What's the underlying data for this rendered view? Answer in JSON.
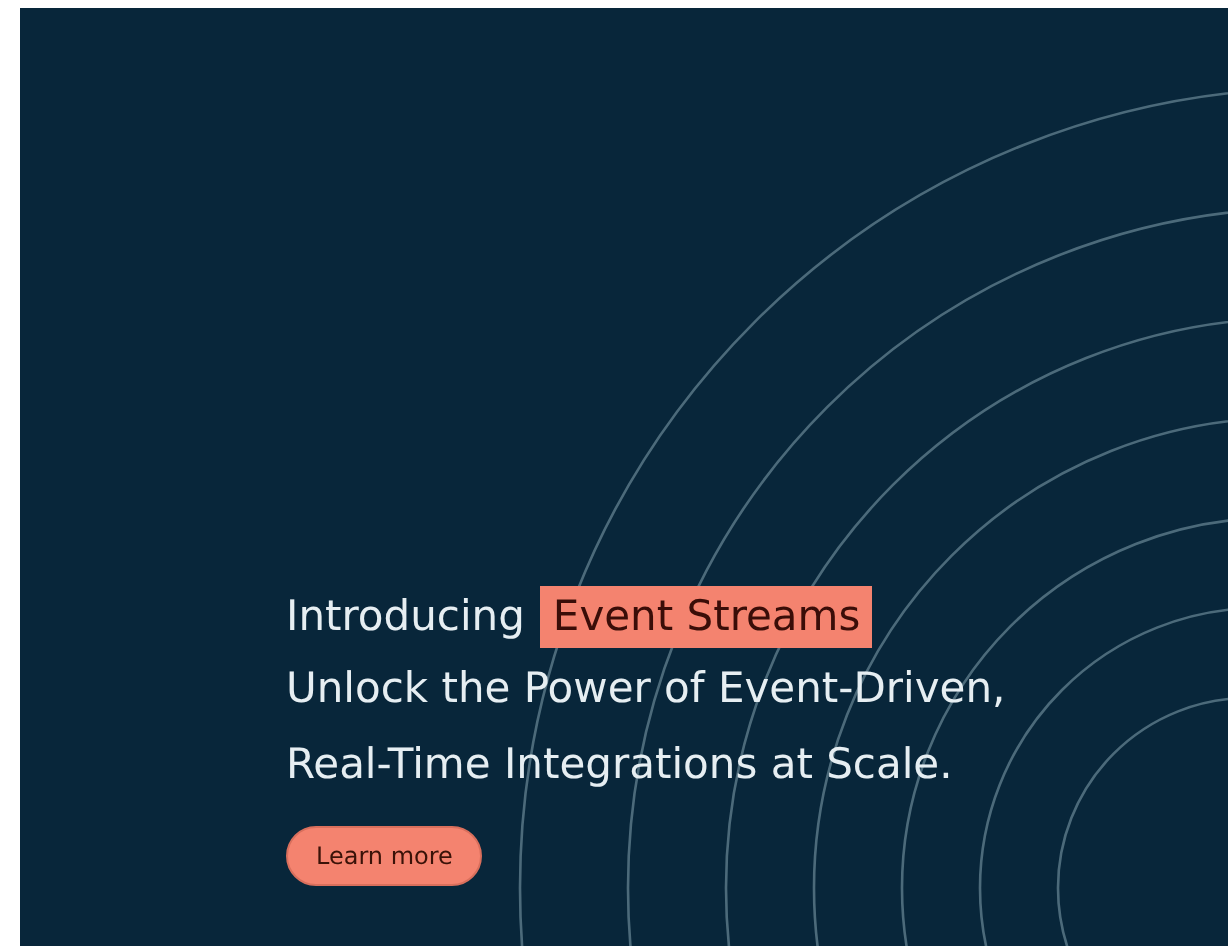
{
  "banner": {
    "heading": {
      "intro": "Introducing",
      "highlight": "Event Streams"
    },
    "subtitle_lines": [
      "Unlock the Power of Event-Driven,",
      "Real-Time Integrations at Scale."
    ],
    "button": "Learn more"
  }
}
